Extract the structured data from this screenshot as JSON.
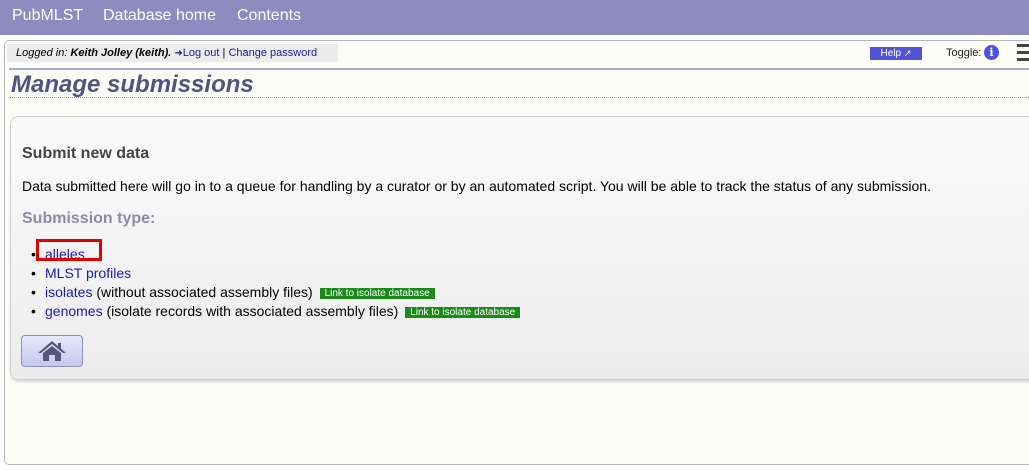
{
  "nav": {
    "brand": "PubMLST",
    "db_home": "Database home",
    "contents": "Contents"
  },
  "status": {
    "logged_in_label": "Logged in:",
    "user": "Keith Jolley (keith).",
    "logout": "Log out",
    "separator": "|",
    "change_password": "Change password"
  },
  "toolbar": {
    "help": "Help",
    "toggle_label": "Toggle:",
    "info_glyph": "i"
  },
  "page": {
    "title": "Manage submissions"
  },
  "submit": {
    "heading": "Submit new data",
    "description": "Data submitted here will go in to a queue for handling by a curator or by an automated script. You will be able to track the status of any submission.",
    "type_heading": "Submission type:",
    "items": [
      {
        "link": "alleles",
        "note": "",
        "badge": ""
      },
      {
        "link": "MLST profiles",
        "note": "",
        "badge": ""
      },
      {
        "link": "isolates",
        "note": " (without associated assembly files)",
        "badge": "Link to isolate database"
      },
      {
        "link": "genomes",
        "note": " (isolate records with associated assembly files)",
        "badge": "Link to isolate database"
      }
    ]
  },
  "colors": {
    "nav_bg": "#8c8cc1",
    "title": "#535380",
    "link": "#1a1ab0",
    "badge_bg": "#1a8a1a",
    "highlight": "#e00000"
  },
  "icons": [
    "logout-icon",
    "external-link-icon",
    "info-icon",
    "hamburger-menu-icon",
    "home-icon"
  ]
}
